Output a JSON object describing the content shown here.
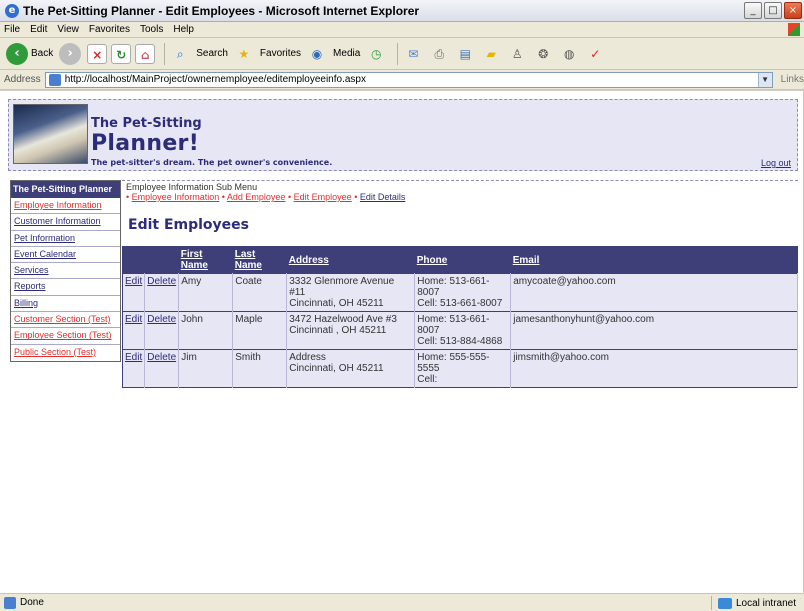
{
  "window": {
    "title": "The Pet-Sitting Planner - Edit Employees - Microsoft Internet Explorer",
    "minimize": "_",
    "maximize": "□",
    "close": "×"
  },
  "menu": [
    "File",
    "Edit",
    "View",
    "Favorites",
    "Tools",
    "Help"
  ],
  "toolbar": {
    "back_label": "Back",
    "search_label": "Search",
    "favorites_label": "Favorites",
    "media_label": "Media"
  },
  "address": {
    "label": "Address",
    "url": "http://localhost/MainProject/ownernemployee/editemployeeinfo.aspx",
    "links_label": "Links"
  },
  "header": {
    "line1": "The Pet-Sitting",
    "line2": "Planner!",
    "tagline": "The pet-sitter's dream. The pet owner's convenience.",
    "logout": "Log out"
  },
  "sidebar": {
    "title": "The Pet-Sitting Planner",
    "items": [
      {
        "label": "Employee Information",
        "color": "red"
      },
      {
        "label": "Customer Information",
        "color": "blue"
      },
      {
        "label": "Pet Information",
        "color": "blue"
      },
      {
        "label": "Event Calendar",
        "color": "blue"
      },
      {
        "label": "Services",
        "color": "blue"
      },
      {
        "label": "Reports",
        "color": "blue"
      },
      {
        "label": "Billing",
        "color": "blue"
      },
      {
        "label": "Customer Section (Test)",
        "color": "red"
      },
      {
        "label": "Employee Section (Test)",
        "color": "red"
      },
      {
        "label": "Public Section (Test)",
        "color": "red"
      }
    ]
  },
  "submenu": {
    "title": "Employee Information Sub Menu",
    "links": [
      "Employee Information",
      "Add Employee",
      "Edit Employee",
      "Edit Details"
    ],
    "separator": "•"
  },
  "main": {
    "heading": "Edit Employees",
    "columns": [
      "",
      "",
      "First Name",
      "Last Name",
      "Address",
      "Phone",
      "Email"
    ],
    "edit_label": "Edit",
    "delete_label": "Delete",
    "rows": [
      {
        "first": "Amy",
        "last": "Coate",
        "address1": "3332 Glenmore Avenue #11",
        "address2": "Cincinnati, OH 45211",
        "phone1": "Home: 513-661-8007",
        "phone2": "Cell: 513-661-8007",
        "email": "amycoate@yahoo.com"
      },
      {
        "first": "John",
        "last": "Maple",
        "address1": "3472 Hazelwood Ave #3",
        "address2": "Cincinnati , OH 45211",
        "phone1": "Home: 513-661-8007",
        "phone2": "Cell: 513-884-4868",
        "email": "jamesanthonyhunt@yahoo.com"
      },
      {
        "first": "Jim",
        "last": "Smith",
        "address1": "Address",
        "address2": "Cincinnati, OH 45211",
        "phone1": "Home: 555-555-5555",
        "phone2": "Cell:",
        "email": "jimsmith@yahoo.com"
      }
    ]
  },
  "status": {
    "text": "Done",
    "zone": "Local intranet"
  },
  "colors": {
    "nav_dark": "#3e3e79",
    "panel_bg": "#e6e6f5",
    "link_red": "#e03030",
    "link_blue": "#2c2c7a"
  }
}
